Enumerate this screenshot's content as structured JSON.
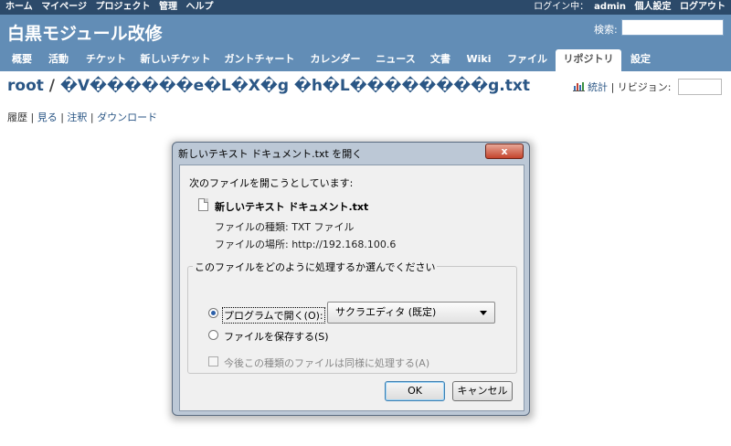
{
  "topbar": {
    "left": [
      "ホーム",
      "マイページ",
      "プロジェクト",
      "管理",
      "ヘルプ"
    ],
    "logged_in": "ログイン中：",
    "user": "admin",
    "personal": "個人設定",
    "logout": "ログアウト"
  },
  "header": {
    "project_title": "白黒モジュール改修",
    "search_label": "検索:",
    "search_value": ""
  },
  "tabs": [
    "概要",
    "活動",
    "チケット",
    "新しいチケット",
    "ガントチャート",
    "カレンダー",
    "ニュース",
    "文書",
    "Wiki",
    "ファイル",
    "リポジトリ",
    "設定"
  ],
  "active_tab": "リポジトリ",
  "breadcrumb": {
    "root": "root",
    "sep": "/",
    "file": "�V������e�L�X�g �h�L��������g.txt"
  },
  "stats": {
    "stats_label": "統計",
    "pipe": "|",
    "revision_label": "リビジョン:",
    "revision_value": ""
  },
  "sublinks": [
    "履歴",
    "見る",
    "注釈",
    "ダウンロード"
  ],
  "dialog": {
    "title": "新しいテキスト ドキュメント.txt を開く",
    "close": "x",
    "intro": "次のファイルを開こうとしています:",
    "filename": "新しいテキスト ドキュメント.txt",
    "file_type": "ファイルの種類: TXT ファイル",
    "file_location": "ファイルの場所: http://192.168.100.6",
    "group_label": "このファイルをどのように処理するか選んでください",
    "open_with_label": "プログラムで開く(O):",
    "open_with_app": "サクラエディタ (既定)",
    "save_label": "ファイルを保存する(S)",
    "remember_label": "今後この種類のファイルは同様に処理する(A)",
    "ok": "OK",
    "cancel": "キャンセル"
  }
}
